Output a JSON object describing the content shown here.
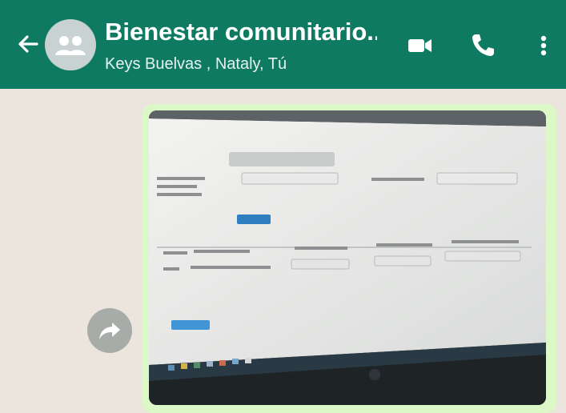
{
  "header": {
    "title": "Bienestar comunitario...",
    "subtitle": "Keys Buelvas , Nataly, Tú",
    "icons": {
      "back": "arrow-left-icon",
      "avatar": "group-avatar-icon",
      "video": "video-camera-icon",
      "call": "phone-icon",
      "menu": "more-vertical-icon"
    }
  },
  "message": {
    "type": "image",
    "description_icon": "forward-icon"
  },
  "colors": {
    "header_bg": "#0f7a62",
    "chat_bg": "#ece5dd",
    "bubble_bg": "#dcf8c6"
  }
}
